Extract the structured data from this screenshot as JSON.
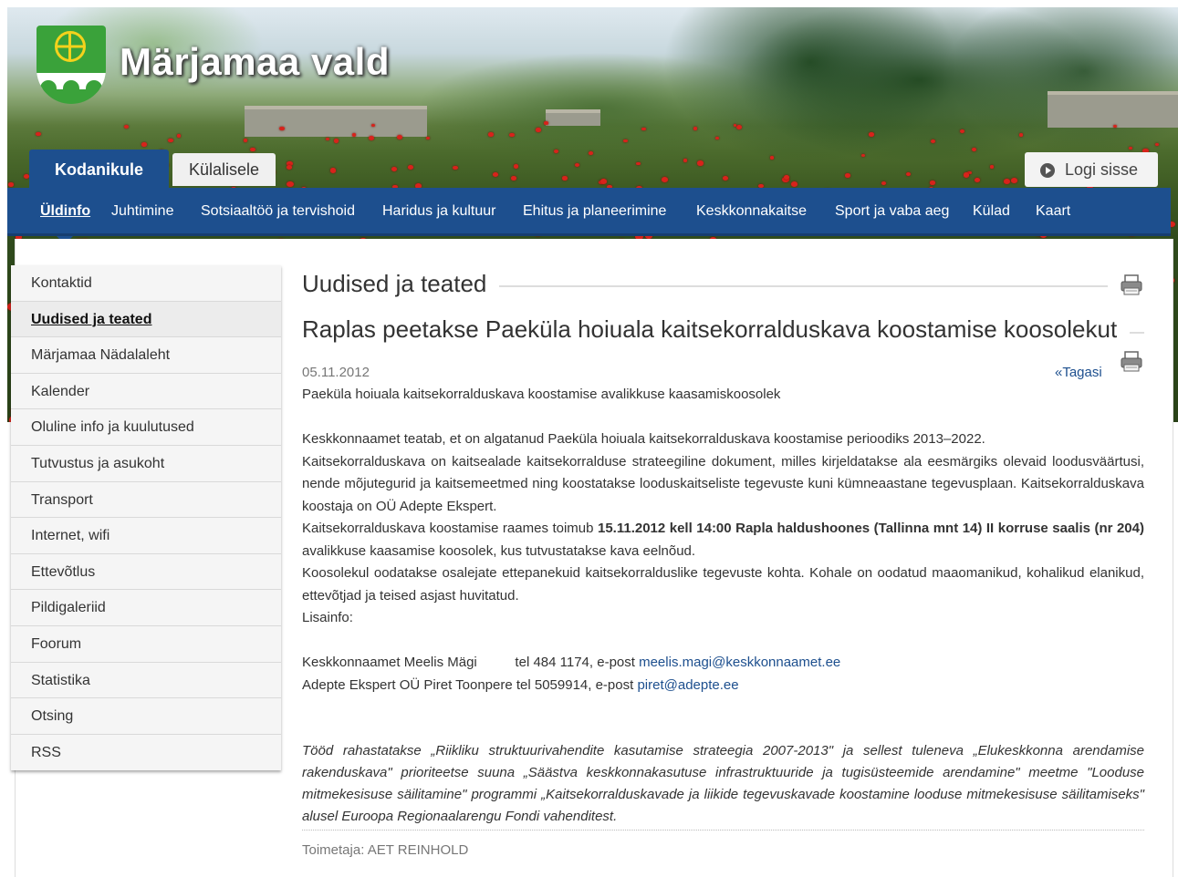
{
  "site": {
    "title": "Märjamaa vald",
    "audience_tabs": [
      {
        "label": "Kodanikule",
        "active": true
      },
      {
        "label": "Külalisele",
        "active": false
      }
    ],
    "login_label": "Logi sisse"
  },
  "main_nav": [
    {
      "label": "Üldinfo",
      "active": true
    },
    {
      "label": "Juhtimine"
    },
    {
      "label": "Sotsiaaltöö ja tervishoid"
    },
    {
      "label": "Haridus ja kultuur"
    },
    {
      "label": "Ehitus ja planeerimine"
    },
    {
      "label": "Keskkonnakaitse"
    },
    {
      "label": "Sport ja vaba aeg"
    },
    {
      "label": "Külad"
    },
    {
      "label": "Kaart"
    }
  ],
  "sidebar": [
    {
      "label": "Kontaktid"
    },
    {
      "label": "Uudised ja teated",
      "active": true
    },
    {
      "label": "Märjamaa Nädalaleht"
    },
    {
      "label": "Kalender"
    },
    {
      "label": "Oluline info ja kuulutused"
    },
    {
      "label": "Tutvustus ja asukoht"
    },
    {
      "label": "Transport"
    },
    {
      "label": "Internet, wifi"
    },
    {
      "label": "Ettevõtlus"
    },
    {
      "label": "Pildigaleriid"
    },
    {
      "label": "Foorum"
    },
    {
      "label": "Statistika"
    },
    {
      "label": "Otsing"
    },
    {
      "label": "RSS"
    }
  ],
  "article": {
    "section_heading": "Uudised ja teated",
    "title": "Raplas peetakse Paeküla hoiuala kaitsekorralduskava koostamise koosolekut",
    "date": "05.11.2012",
    "back_label": "«Tagasi",
    "lead": "Paeküla hoiuala kaitsekorralduskava koostamise avalikkuse kaasamiskoosolek",
    "p1": "Keskkonnaamet teatab, et on algatanud Paeküla hoiuala kaitsekorralduskava koostamise perioodiks 2013–2022.",
    "p2": "Kaitsekorralduskava on kaitsealade kaitsekorralduse strateegiline dokument, milles kirjeldatakse ala eesmärgiks olevaid loodusväärtusi, nende mõjutegurid ja kaitsemeetmed ning koostatakse looduskaitseliste tegevuste kuni kümneaastane tegevusplaan. Kaitsekorralduskava koostaja on OÜ Adepte Ekspert.",
    "p3_before": "Kaitsekorralduskava koostamise raames toimub ",
    "p3_bold": "15.11.2012 kell 14:00 Rapla haldushoones (Tallinna mnt 14) II korruse saalis (nr 204)",
    "p3_after": " avalikkuse kaasamise koosolek, kus tutvustatakse kava eelnõud.",
    "p4": "Koosolekul oodatakse osalejate ettepanekuid kaitsekorralduslike tegevuste kohta. Kohale on oodatud maaomanikud, kohalikud elanikud, ettevõtjad ja teised asjast huvitatud.",
    "more_info_label": "Lisainfo:",
    "contact1_text": "Keskkonnaamet Meelis Mägi          tel 484 1174, e-post ",
    "contact1_email": "meelis.magi@keskkonnaamet.ee",
    "contact2_text": "Adepte Ekspert OÜ Piret Toonpere tel 5059914, e-post ",
    "contact2_email": "piret@adepte.ee",
    "funding": "Tööd rahastatakse „Riikliku struktuurivahendite kasutamise strateegia 2007-2013\" ja sellest tuleneva „Elukeskkonna arendamise rakenduskava\" prioriteetse suuna „Säästva keskkonnakasutuse infrastruktuuride ja tugisüsteemide arendamine\" meetme \"Looduse mitmekesisuse säilitamine\" programmi „Kaitsekorralduskavade ja liikide tegevuskavade koostamine looduse mitmekesisuse säilitamiseks\" alusel Euroopa Regionaalarengu Fondi vahenditest.",
    "editor": "Toimetaja: AET REINHOLD"
  },
  "colors": {
    "nav_blue": "#1d4f8e",
    "link_blue": "#1d4f8e",
    "logo_green": "#3aa23a",
    "logo_yellow": "#f4d21c"
  },
  "icons": [
    "logo-coat-of-arms",
    "arrow-circle-icon",
    "printer-icon"
  ]
}
